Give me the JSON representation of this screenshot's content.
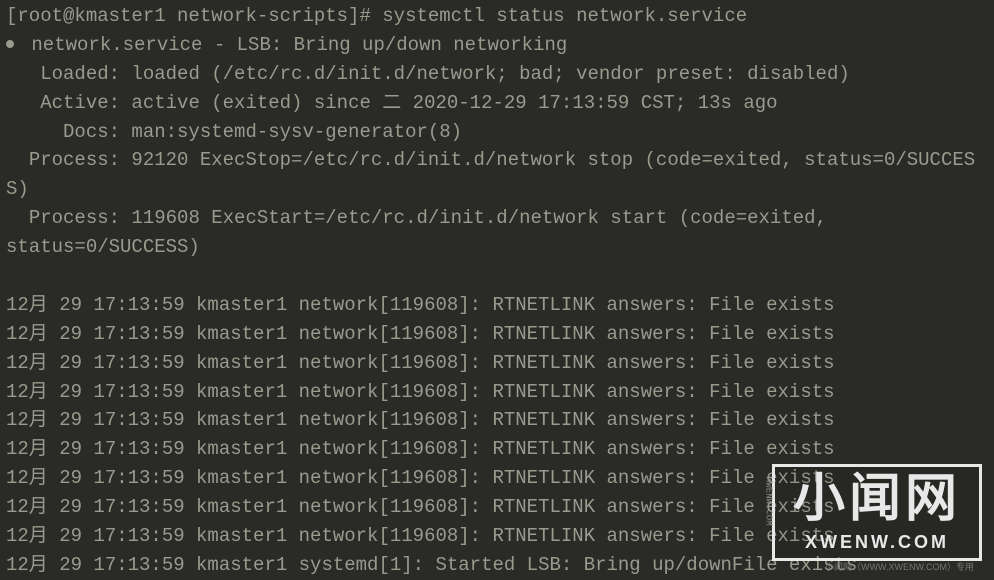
{
  "prompt": "[root@kmaster1 network-scripts]# systemctl status network.service",
  "service": {
    "header": " network.service - LSB: Bring up/down networking",
    "loaded": "   Loaded: loaded (/etc/rc.d/init.d/network; bad; vendor preset: disabled)",
    "active": "   Active: active (exited) since 二 2020-12-29 17:13:59 CST; 13s ago",
    "docs": "     Docs: man:systemd-sysv-generator(8)",
    "process1": "  Process: 92120 ExecStop=/etc/rc.d/init.d/network stop (code=exited, status=0/SUCCESS)",
    "process2_a": "  Process: 119608 ExecStart=/etc/rc.d/init.d/network start (code=exited, ",
    "process2_b": "status=0/SUCCESS)"
  },
  "logs": [
    "12月 29 17:13:59 kmaster1 network[119608]: RTNETLINK answers: File exists",
    "12月 29 17:13:59 kmaster1 network[119608]: RTNETLINK answers: File exists",
    "12月 29 17:13:59 kmaster1 network[119608]: RTNETLINK answers: File exists",
    "12月 29 17:13:59 kmaster1 network[119608]: RTNETLINK answers: File exists",
    "12月 29 17:13:59 kmaster1 network[119608]: RTNETLINK answers: File exists",
    "12月 29 17:13:59 kmaster1 network[119608]: RTNETLINK answers: File exists",
    "12月 29 17:13:59 kmaster1 network[119608]: RTNETLINK answers: File exists",
    "12月 29 17:13:59 kmaster1 network[119608]: RTNETLINK answers: File exists",
    "12月 29 17:13:59 kmaster1 network[119608]: RTNETLINK answers: File exists",
    "12月 29 17:13:59 kmaster1 systemd[1]: Started LSB: Bring up/downFile exists"
  ],
  "watermark": {
    "main": "小闻网",
    "sub": "XWENW.COM",
    "tiny": "XWENW.COM",
    "bottom": "小闻网（WWW.XWENW.COM）专用"
  }
}
